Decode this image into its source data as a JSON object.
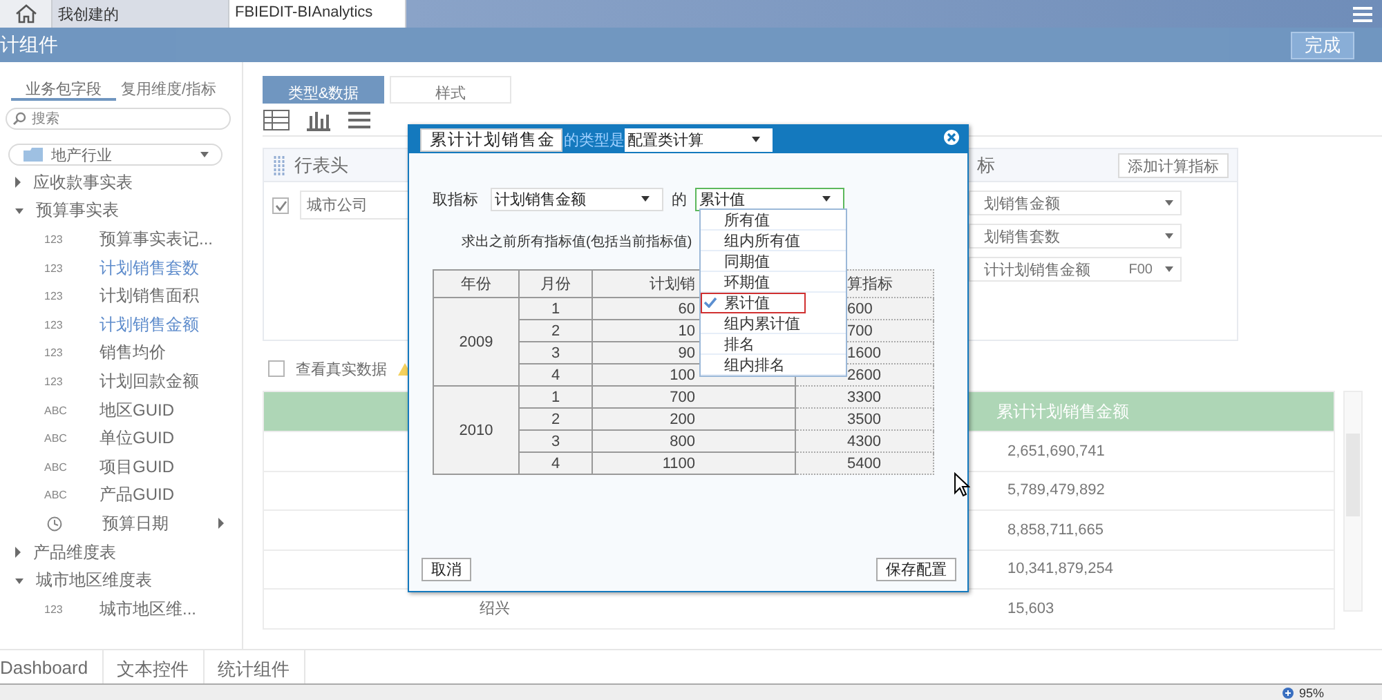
{
  "top_bar": {
    "tabs": [
      {
        "label": "我创建的",
        "selected": false
      },
      {
        "label": "FBIEDIT-BIAnalytics",
        "selected": true
      }
    ]
  },
  "header": {
    "title": "计组件",
    "done_button": "完成"
  },
  "sidebar": {
    "tabs": [
      {
        "label": "业务包字段",
        "selected": true
      },
      {
        "label": "复用维度/指标",
        "selected": false
      }
    ],
    "search": {
      "placeholder": "搜索"
    },
    "package": "地产行业",
    "tree": [
      {
        "label": "应收款事实表",
        "expanded": false
      },
      {
        "label": "预算事实表",
        "expanded": true,
        "children": [
          {
            "label": "预算事实表记...",
            "kind": "field",
            "badge": "123",
            "used": false
          },
          {
            "label": "计划销售套数",
            "kind": "field",
            "badge": "123",
            "used": true
          },
          {
            "label": "计划销售面积",
            "kind": "field",
            "badge": "123",
            "used": false
          },
          {
            "label": "计划销售金额",
            "kind": "field",
            "badge": "123",
            "used": true
          },
          {
            "label": "销售均价",
            "kind": "field",
            "badge": "123",
            "used": false
          },
          {
            "label": "计划回款金额",
            "kind": "field",
            "badge": "123",
            "used": false
          },
          {
            "label": "地区GUID",
            "kind": "field",
            "badge": "ABC",
            "used": false
          },
          {
            "label": "单位GUID",
            "kind": "field",
            "badge": "ABC",
            "used": false
          },
          {
            "label": "项目GUID",
            "kind": "field",
            "badge": "ABC",
            "used": false
          },
          {
            "label": "产品GUID",
            "kind": "field",
            "badge": "ABC",
            "used": false
          },
          {
            "label": "预算日期",
            "kind": "date",
            "used": false
          }
        ]
      },
      {
        "label": "产品维度表",
        "expanded": false
      },
      {
        "label": "城市地区维度表",
        "expanded": true,
        "children": [
          {
            "label": "城市地区维...",
            "kind": "field",
            "badge": "123",
            "used": false
          }
        ]
      }
    ]
  },
  "editor": {
    "tabs": [
      {
        "label": "类型&数据",
        "selected": true
      },
      {
        "label": "样式",
        "selected": false
      }
    ],
    "rows_panel": {
      "title": "行表头",
      "fields": [
        {
          "label": "城市公司",
          "checked": true
        }
      ]
    },
    "metrics_panel": {
      "title": "标",
      "add_button": "添加计算指标",
      "fields": [
        {
          "label": "划销售金额"
        },
        {
          "label": "划销售套数"
        },
        {
          "label": "计计划销售金额",
          "format": "F00"
        }
      ]
    },
    "real_data": {
      "label": "查看真实数据",
      "checked": false
    },
    "preview": {
      "header": "累计计划销售金额",
      "rows": [
        {
          "value": "2,651,690,741"
        },
        {
          "value": "5,789,479,892"
        },
        {
          "value": "8,858,711,665"
        },
        {
          "value": "10,341,879,254"
        },
        {
          "city": "绍兴",
          "value": "15,603"
        }
      ]
    }
  },
  "bottom_tabs": [
    {
      "label": "Dashboard"
    },
    {
      "label": "文本控件"
    },
    {
      "label": "统计组件"
    }
  ],
  "status_bar": {
    "zoom": "95%"
  },
  "dialog": {
    "name_field": "累计计划销售金",
    "type_label": "的类型是",
    "type_select": "配置类计算",
    "metric_label": "取指标",
    "metric_select": "计划销售金额",
    "of_label": "的",
    "calc_select": "累计值",
    "description": "求出之前所有指标值(包括当前指标值)",
    "table": {
      "columns": [
        "年份",
        "月份",
        "计划销",
        "算指标"
      ],
      "groups": [
        {
          "year": "2009",
          "rows": [
            {
              "month": "1",
              "value": "60",
              "result": "600"
            },
            {
              "month": "2",
              "value": "10",
              "result": "700"
            },
            {
              "month": "3",
              "value": "90",
              "result": "1600"
            },
            {
              "month": "4",
              "value": "100",
              "result": "2600"
            }
          ]
        },
        {
          "year": "2010",
          "rows": [
            {
              "month": "1",
              "value": "700",
              "result": "3300"
            },
            {
              "month": "2",
              "value": "200",
              "result": "3500"
            },
            {
              "month": "3",
              "value": "800",
              "result": "4300"
            },
            {
              "month": "4",
              "value": "1100",
              "result": "5400"
            }
          ]
        }
      ]
    },
    "menu": [
      {
        "label": "所有值",
        "selected": false
      },
      {
        "label": "组内所有值",
        "selected": false
      },
      {
        "label": "同期值",
        "selected": false
      },
      {
        "label": "环期值",
        "selected": false
      },
      {
        "label": "累计值",
        "selected": true
      },
      {
        "label": "组内累计值",
        "selected": false
      },
      {
        "label": "排名",
        "selected": false
      },
      {
        "label": "组内排名",
        "selected": false
      }
    ],
    "cancel_button": "取消",
    "save_button": "保存配置"
  }
}
